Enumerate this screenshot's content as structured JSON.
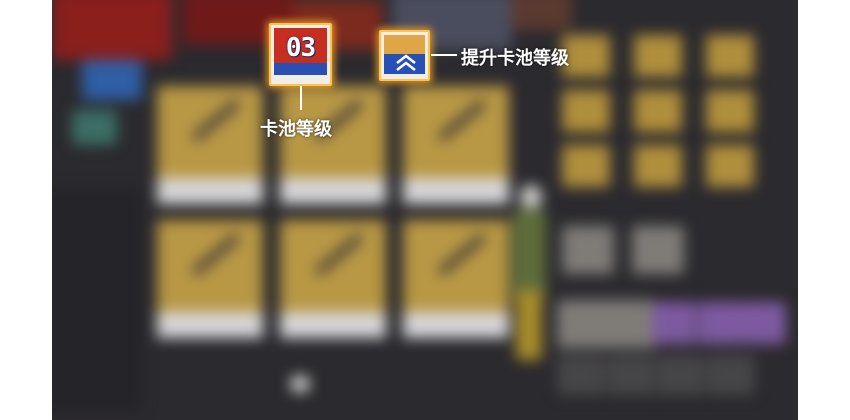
{
  "level_badge": {
    "number": "03"
  },
  "labels": {
    "pool_level": "卡池等级",
    "upgrade_pool_level": "提升卡池等级"
  },
  "colors": {
    "highlight_border": "#ffc24a",
    "badge_red": "#c62e22",
    "badge_blue": "#2a4fb2",
    "label_text": "#ffffff"
  }
}
